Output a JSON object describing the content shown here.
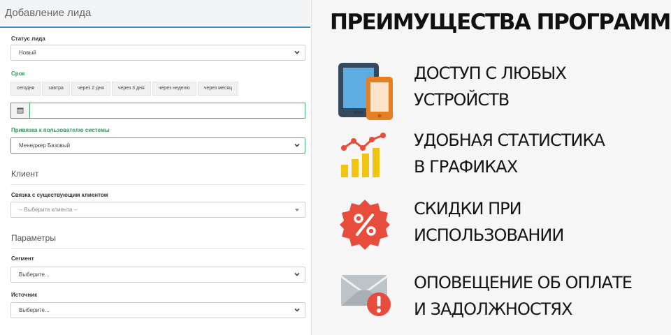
{
  "form": {
    "title": "Добавление лида",
    "status": {
      "label": "Статус лида",
      "value": "Новый"
    },
    "deadline": {
      "label": "Срок",
      "chips": [
        "сегодня",
        "завтра",
        "через 2 дня",
        "через 3 дня",
        "через неделю",
        "через месяц"
      ],
      "date_value": ""
    },
    "assign": {
      "label": "Привязка к пользователю системы",
      "value": "Менеджер Базовый"
    },
    "client_section": "Клиент",
    "client_link": {
      "label": "Связка с существующим клиентом",
      "placeholder": "-- Выберите клиента --"
    },
    "params_section": "Параметры",
    "segment": {
      "label": "Сегмент",
      "value": "Выберите..."
    },
    "source": {
      "label": "Источник",
      "value": "Выберите..."
    }
  },
  "promo": {
    "title": "ПРЕИМУЩЕСТВА ПРОГРАММЫ",
    "features": [
      {
        "icon": "devices-icon",
        "line1": "ДОСТУП С ЛЮБЫХ",
        "line2": "УСТРОЙСТВ"
      },
      {
        "icon": "chart-icon",
        "line1": "УДОБНАЯ СТАТИСТИКА",
        "line2": "В ГРАФИКАХ"
      },
      {
        "icon": "discount-icon",
        "line1": "СКИДКИ ПРИ",
        "line2": "ИСПОЛЬЗОВАНИИ"
      },
      {
        "icon": "mail-alert-icon",
        "line1": "ОПОВЕЩЕНИЕ ОБ ОПЛАТЕ",
        "line2": "И ЗАДОЛЖНОСТЯХ"
      }
    ]
  },
  "colors": {
    "accent_blue": "#3c8dbc",
    "accent_green": "#2e9b57",
    "chart_red": "#e74c3c",
    "chart_yellow": "#f1c40f",
    "discount_red": "#e74c3c",
    "tablet_orange": "#e67e22"
  }
}
